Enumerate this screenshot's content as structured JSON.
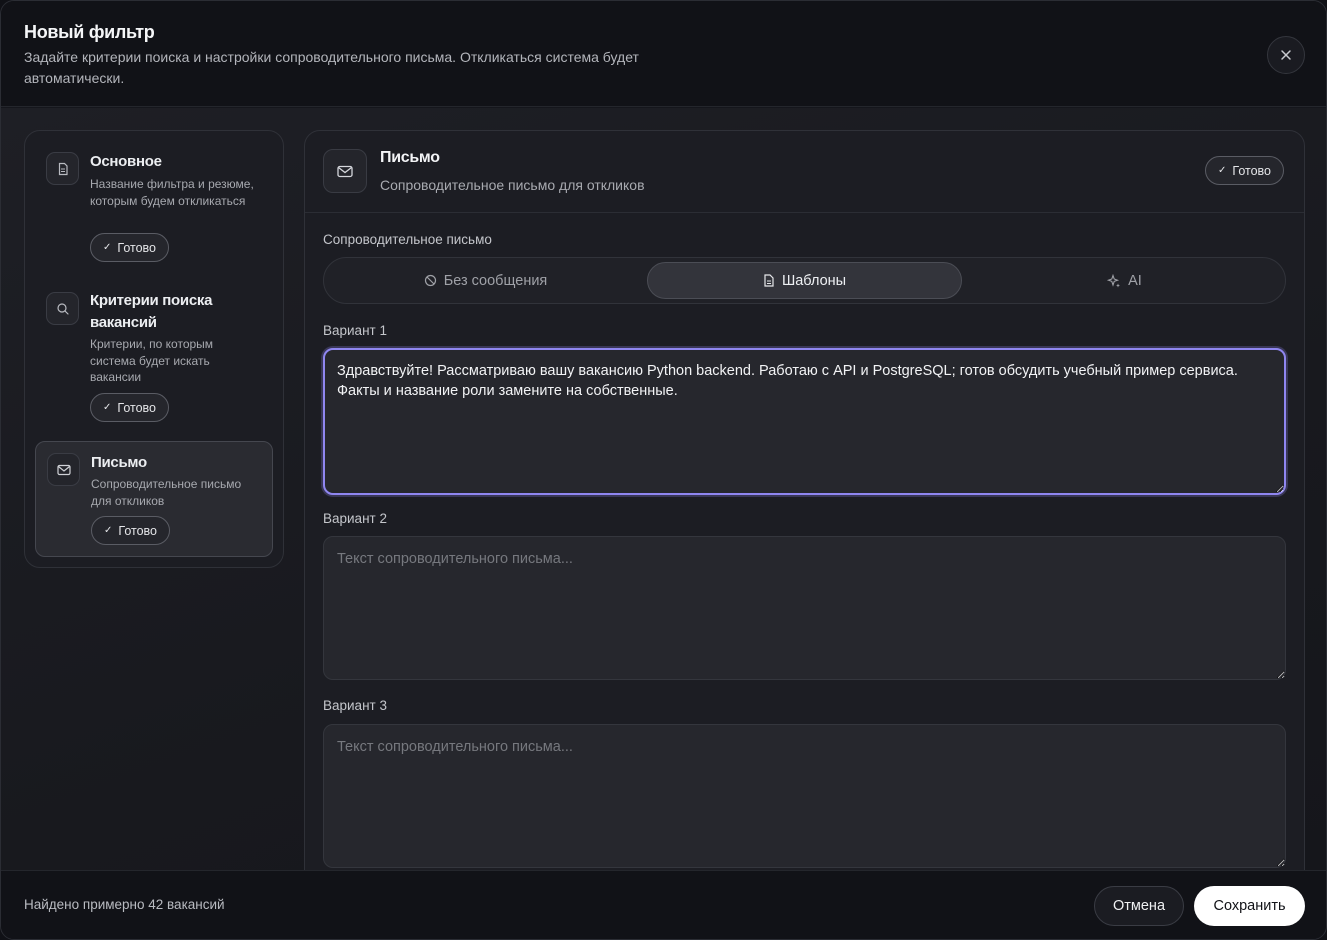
{
  "header": {
    "title": "Новый фильтр",
    "subtitle": "Задайте критерии поиска и настройки сопроводительного письма. Откликаться система будет автоматически.",
    "close_icon": "close-icon"
  },
  "sidebar": {
    "steps": [
      {
        "icon": "document-icon",
        "title": "Основное",
        "desc": "Название фильтра и резюме, которым будем откликаться",
        "badge": "Готово",
        "active": false
      },
      {
        "icon": "search-icon",
        "title": "Критерии поиска вакансий",
        "desc": "Критерии, по которым система будет искать вакансии",
        "badge": "Готово",
        "active": false
      },
      {
        "icon": "mail-icon",
        "title": "Письмо",
        "desc": "Сопроводительное письмо для откликов",
        "badge": "Готово",
        "active": true
      }
    ]
  },
  "panel": {
    "icon": "mail-icon",
    "title": "Письмо",
    "subtitle": "Сопроводительное письмо для откликов",
    "badge": "Готово",
    "section_label": "Сопроводительное письмо",
    "modes": [
      {
        "icon": "ban-icon",
        "label": "Без сообщения",
        "active": false
      },
      {
        "icon": "document-icon",
        "label": "Шаблоны",
        "active": true
      },
      {
        "icon": "sparkles-icon",
        "label": "AI",
        "active": false
      }
    ],
    "variants": [
      {
        "label": "Вариант 1",
        "value": "Здравствуйте! Рассматриваю вашу вакансию Python backend. Работаю с API и PostgreSQL; готов обсудить учебный пример сервиса. Факты и название роли замените на собственные.",
        "placeholder": "Текст сопроводительного письма..."
      },
      {
        "label": "Вариант 2",
        "value": "",
        "placeholder": "Текст сопроводительного письма..."
      },
      {
        "label": "Вариант 3",
        "value": "",
        "placeholder": "Текст сопроводительного письма..."
      }
    ]
  },
  "footer": {
    "found_text": "Найдено примерно 42 вакансий",
    "cancel_label": "Отмена",
    "save_label": "Сохранить"
  },
  "colors": {
    "accent_focus": "#8f86f0",
    "background": "#15161c",
    "save_button": "#ffffff"
  }
}
